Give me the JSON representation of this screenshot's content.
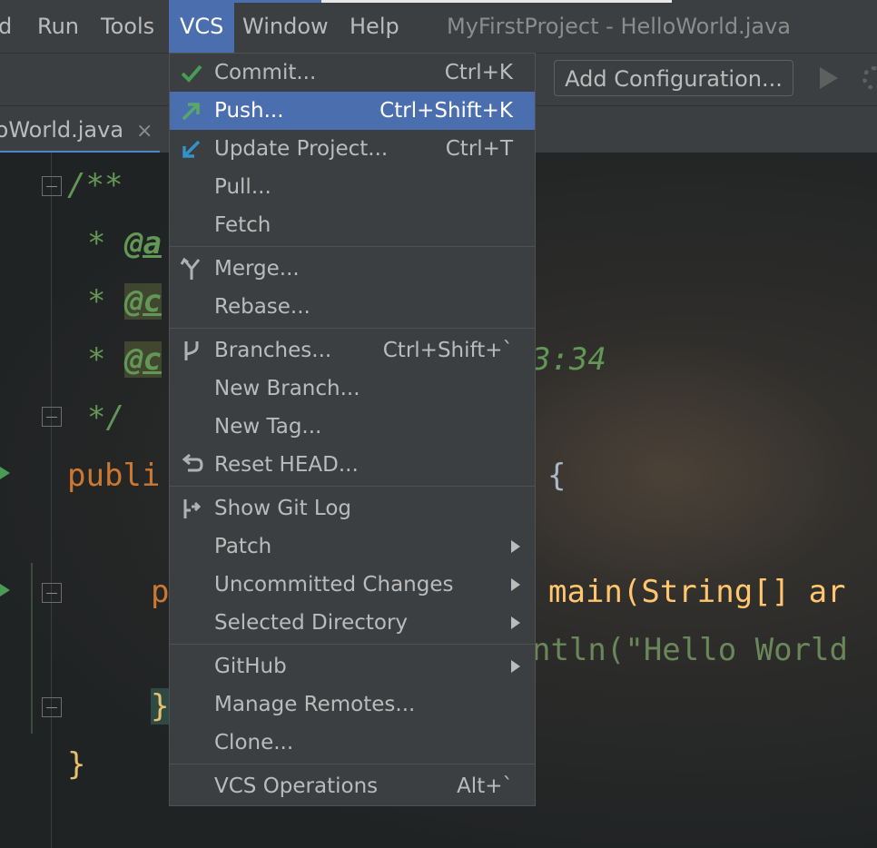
{
  "menubar": {
    "items": [
      "d",
      "Run",
      "Tools",
      "VCS",
      "Window",
      "Help"
    ],
    "title": "MyFirstProject - HelloWorld.java"
  },
  "toolbar": {
    "add_configuration": "Add Configuration..."
  },
  "tab": {
    "label": "loWorld.java",
    "close": "×"
  },
  "editor": {
    "lines": {
      "l1": "/**",
      "l2": "@a",
      "l3": "@c",
      "l4": "@c",
      "l4tail": "3:34",
      "l5": "*/",
      "l6a": "publi",
      "l6b": "d {",
      "l7a": "p",
      "l7b": "main(String[] ar",
      "l8": "ntln(\"Hello World",
      "l9": "}",
      "l10": "}"
    },
    "star": "*"
  },
  "vcs_menu": {
    "commit": {
      "label": "Commit...",
      "shortcut": "Ctrl+K"
    },
    "push": {
      "label": "Push...",
      "shortcut": "Ctrl+Shift+K"
    },
    "update": {
      "label": "Update Project...",
      "shortcut": "Ctrl+T"
    },
    "pull": {
      "label": "Pull..."
    },
    "fetch": {
      "label": "Fetch"
    },
    "merge": {
      "label": "Merge..."
    },
    "rebase": {
      "label": "Rebase..."
    },
    "branches": {
      "label": "Branches...",
      "shortcut": "Ctrl+Shift+`"
    },
    "new_branch": {
      "label": "New Branch..."
    },
    "new_tag": {
      "label": "New Tag..."
    },
    "reset_head": {
      "label": "Reset HEAD..."
    },
    "show_git_log": {
      "label": "Show Git Log"
    },
    "patch": {
      "label": "Patch"
    },
    "uncommitted": {
      "label": "Uncommitted Changes"
    },
    "selected_dir": {
      "label": "Selected Directory"
    },
    "github": {
      "label": "GitHub"
    },
    "manage_remotes": {
      "label": "Manage Remotes..."
    },
    "clone": {
      "label": "Clone..."
    },
    "vcs_operations": {
      "label": "VCS Operations",
      "shortcut": "Alt+`"
    }
  },
  "colors": {
    "highlight": "#4b6eaf",
    "menu_bg": "#3c3f41",
    "check_green": "#499c54",
    "update_blue": "#3592c4"
  }
}
